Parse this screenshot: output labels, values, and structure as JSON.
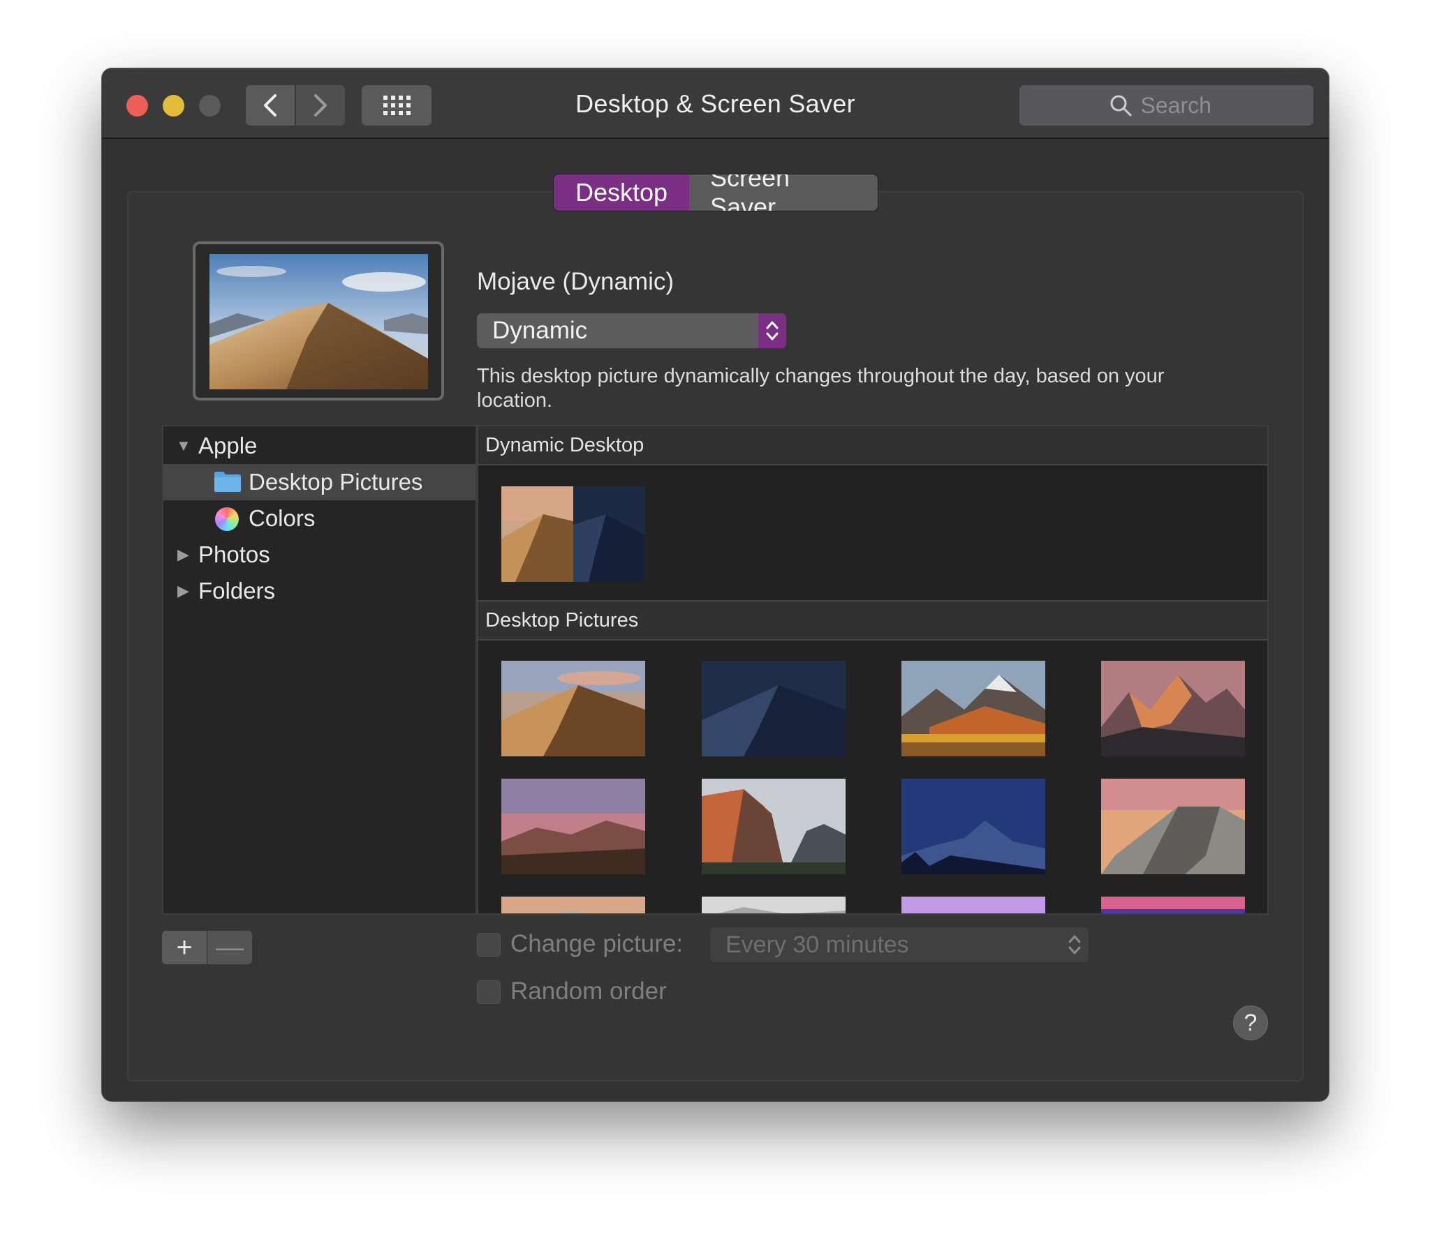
{
  "window": {
    "title": "Desktop & Screen Saver"
  },
  "search": {
    "placeholder": "Search"
  },
  "tabs": [
    {
      "label": "Desktop",
      "active": true
    },
    {
      "label": "Screen Saver",
      "active": false
    }
  ],
  "current_picture": {
    "name": "Mojave (Dynamic)",
    "mode": "Dynamic",
    "description": "This desktop picture dynamically changes throughout the day, based on your location."
  },
  "sources": {
    "apple": "Apple",
    "desktop_pictures": "Desktop Pictures",
    "colors": "Colors",
    "photos": "Photos",
    "folders": "Folders"
  },
  "gallery": {
    "dynamic_header": "Dynamic Desktop",
    "pictures_header": "Desktop Pictures"
  },
  "options": {
    "change_picture_label": "Change picture:",
    "interval": "Every 30 minutes",
    "random_order_label": "Random order",
    "add_label": "+",
    "remove_label": "—",
    "help_label": "?"
  },
  "colors": {
    "accent": "#7b2f84",
    "close": "#ec5f57",
    "minimize": "#e2bd39"
  }
}
